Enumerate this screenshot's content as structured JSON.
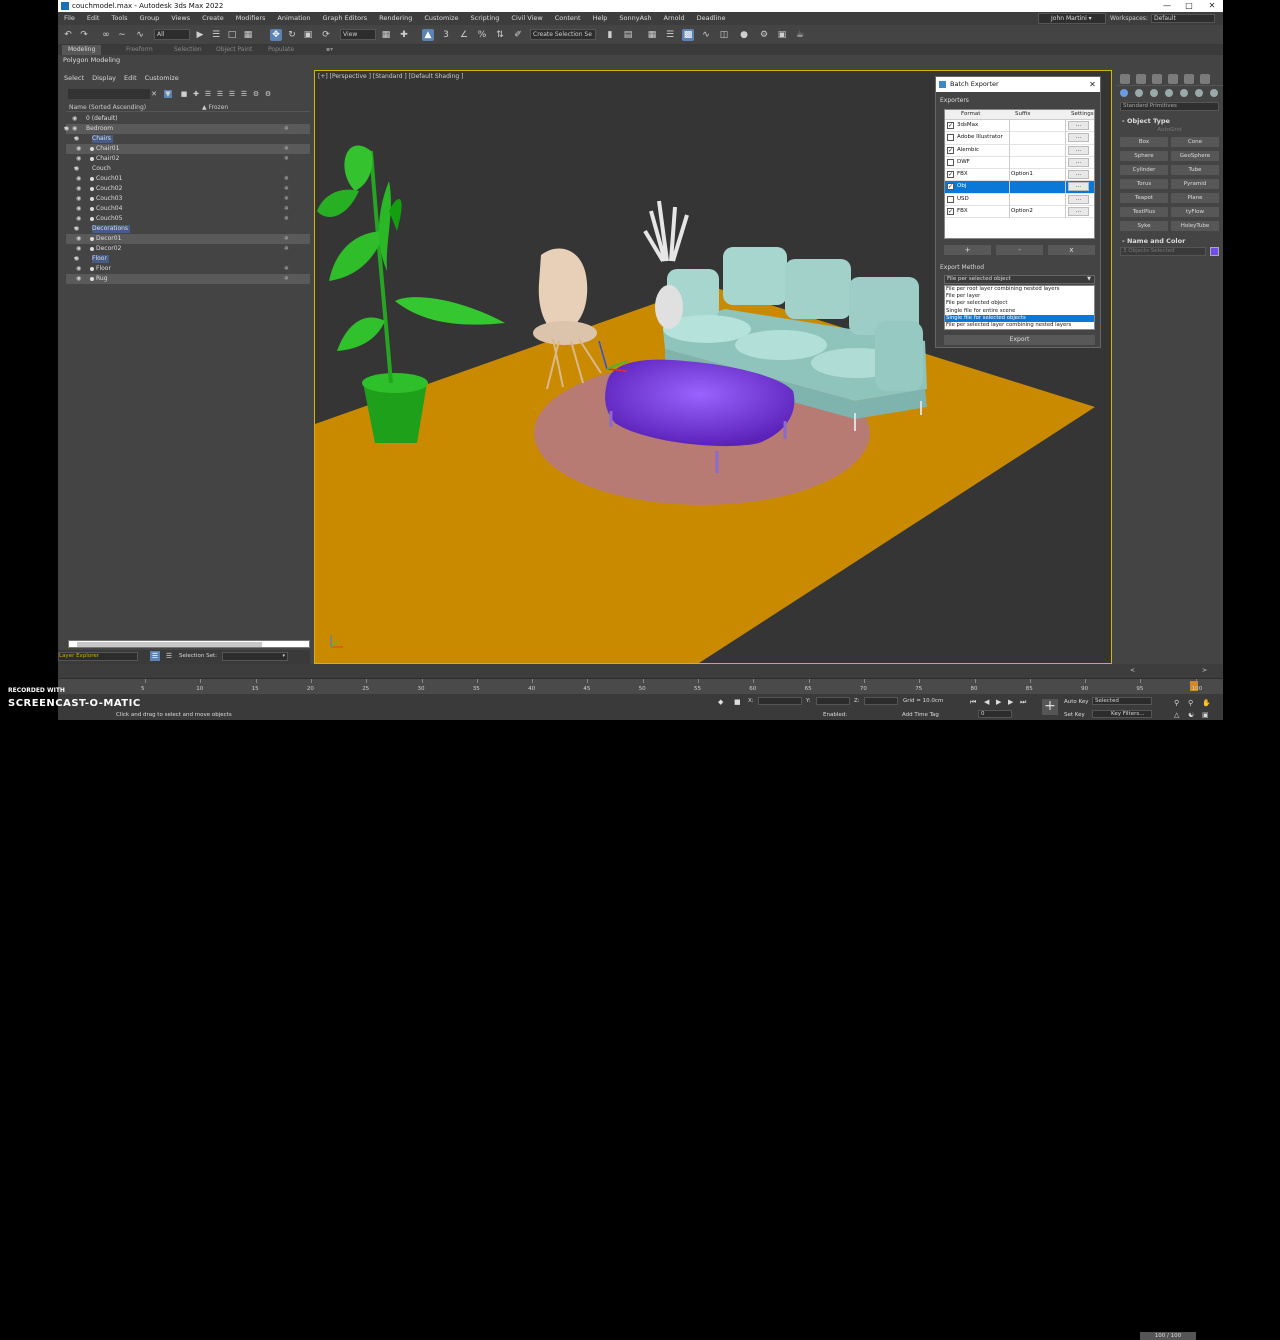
{
  "title": "couchmodel.max - Autodesk 3ds Max 2022",
  "menu": [
    "File",
    "Edit",
    "Tools",
    "Group",
    "Views",
    "Create",
    "Modifiers",
    "Animation",
    "Graph Editors",
    "Rendering",
    "Customize",
    "Scripting",
    "Civil View",
    "Content",
    "Help",
    "SonnyAsh",
    "Arnold",
    "Deadline"
  ],
  "account": {
    "user": "John Martini",
    "workspaces_label": "Workspaces:",
    "workspace": "Default"
  },
  "toolbar": {
    "filter": "All",
    "view": "View",
    "selection_set": "Create Selection Se"
  },
  "ribbon_tabs": [
    "Modeling",
    "Freeform",
    "Selection",
    "Object Paint",
    "Populate"
  ],
  "ribbon_sub": "Polygon Modeling",
  "scene_explorer": {
    "menu": [
      "Select",
      "Display",
      "Edit",
      "Customize"
    ],
    "col_name": "Name (Sorted Ascending)",
    "col_frozen": "▲ Frozen",
    "rows": [
      {
        "name": "0 (default)",
        "indent": 0,
        "hl": false,
        "sel": false
      },
      {
        "name": "Bedroom",
        "indent": 0,
        "hl": false,
        "sel": true
      },
      {
        "name": "Chairs",
        "indent": 1,
        "hl": true,
        "sel": false
      },
      {
        "name": "Chair01",
        "indent": 2,
        "hl": false,
        "sel": true
      },
      {
        "name": "Chair02",
        "indent": 2,
        "hl": false,
        "sel": false
      },
      {
        "name": "Couch",
        "indent": 1,
        "hl": false,
        "sel": false
      },
      {
        "name": "Couch01",
        "indent": 2,
        "hl": false,
        "sel": false
      },
      {
        "name": "Couch02",
        "indent": 2,
        "hl": false,
        "sel": false
      },
      {
        "name": "Couch03",
        "indent": 2,
        "hl": false,
        "sel": false
      },
      {
        "name": "Couch04",
        "indent": 2,
        "hl": false,
        "sel": false
      },
      {
        "name": "Couch05",
        "indent": 2,
        "hl": false,
        "sel": false
      },
      {
        "name": "Decorations",
        "indent": 1,
        "hl": true,
        "sel": false
      },
      {
        "name": "Decor01",
        "indent": 2,
        "hl": false,
        "sel": true
      },
      {
        "name": "Decor02",
        "indent": 2,
        "hl": false,
        "sel": false
      },
      {
        "name": "Floor",
        "indent": 1,
        "hl": true,
        "sel": false
      },
      {
        "name": "Floor",
        "indent": 2,
        "hl": false,
        "sel": false
      },
      {
        "name": "Rug",
        "indent": 2,
        "hl": false,
        "sel": true
      }
    ],
    "footer_label": "Layer Explorer",
    "selection_set_label": "Selection Set:"
  },
  "viewport": {
    "label": "[+] [Perspective ] [Standard ] [Default Shading ]"
  },
  "dialog": {
    "title": "Batch Exporter",
    "exporters_label": "Exporters",
    "headers": {
      "format": "Format",
      "suffix": "Suffix",
      "settings": "Settings"
    },
    "rows": [
      {
        "checked": true,
        "format": "3dsMax",
        "suffix": "",
        "sel": false
      },
      {
        "checked": false,
        "format": "Adobe Illustrator",
        "suffix": "",
        "sel": false
      },
      {
        "checked": true,
        "format": "Alembic",
        "suffix": "",
        "sel": false
      },
      {
        "checked": false,
        "format": "DWF",
        "suffix": "",
        "sel": false
      },
      {
        "checked": true,
        "format": "FBX",
        "suffix": "Option1",
        "sel": false
      },
      {
        "checked": true,
        "format": "Obj",
        "suffix": "",
        "sel": true
      },
      {
        "checked": false,
        "format": "USD",
        "suffix": "",
        "sel": false
      },
      {
        "checked": true,
        "format": "FBX",
        "suffix": "Option2",
        "sel": false
      }
    ],
    "settings_btn": "...",
    "add": "+",
    "remove": "-",
    "clear": "x",
    "method_label": "Export Method",
    "method_value": "File per selected object",
    "method_options": [
      {
        "text": "File per root layer combining nested layers",
        "sel": false
      },
      {
        "text": "File per layer",
        "sel": false
      },
      {
        "text": "File per selected object",
        "sel": false
      },
      {
        "text": "Single file for entire scene",
        "sel": false
      },
      {
        "text": "Single file for selected objects",
        "sel": true
      },
      {
        "text": "File per selected layer combining nested layers",
        "sel": false
      }
    ],
    "export_btn": "Export"
  },
  "command_panel": {
    "dropdown": "Standard Primitives",
    "object_type": "Object Type",
    "autogrid": "AutoGrid",
    "buttons": [
      "Box",
      "Cone",
      "Sphere",
      "GeoSphere",
      "Cylinder",
      "Tube",
      "Torus",
      "Pyramid",
      "Teapot",
      "Plane",
      "TextPlus",
      "tyFlow",
      "Syke",
      "HoleyTube"
    ],
    "name_color": "Name and Color",
    "name_value": "3 Objects Selected",
    "swatch": "#7050e8"
  },
  "timeline": {
    "frames": "100 / 100",
    "ticks": [
      "5",
      "10",
      "15",
      "20",
      "25",
      "30",
      "35",
      "40",
      "45",
      "50",
      "55",
      "60",
      "65",
      "70",
      "75",
      "80",
      "85",
      "90",
      "95",
      "100"
    ]
  },
  "status": {
    "hint": "Click and drag to select and move objects",
    "grid": "Grid = 10.0cm",
    "enabled": "Enabled:",
    "add_time_tag": "Add Time Tag",
    "auto_key": "Auto Key",
    "set_key": "Set Key",
    "selected": "Selected",
    "key_filters": "Key Filters...",
    "frame": "0",
    "x_label": "X:",
    "y_label": "Y:",
    "z_label": "Z:"
  },
  "watermark": {
    "line1": "RECORDED WITH",
    "line2": "SCREENCAST-O-MATIC"
  },
  "colors": {
    "floor": "#c98a00",
    "rug": "#b77a7a",
    "ottoman": "#7b3fe0",
    "couch": "#a7d6cf",
    "plant": "#2dc02a",
    "accent": "#0a78d7"
  }
}
